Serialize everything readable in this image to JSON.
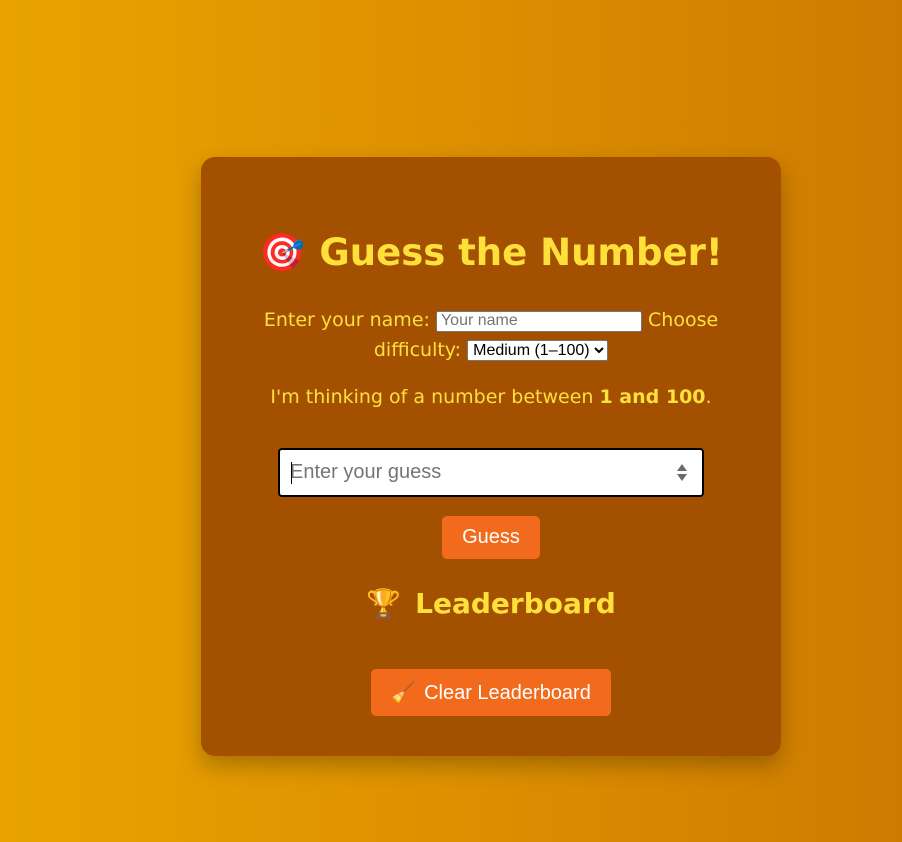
{
  "game": {
    "title_icon": "🎯",
    "title": "Guess the Number!",
    "name_label": "Enter your name:",
    "name_placeholder": "Your name",
    "name_value": "",
    "difficulty_label": "Choose difficulty:",
    "difficulty_selected": "Medium (1–100)",
    "hint_prefix": "I'm thinking of a number between ",
    "hint_range": "1 and 100",
    "hint_suffix": ".",
    "guess_placeholder": "Enter your guess",
    "guess_value": "",
    "guess_button": "Guess"
  },
  "leaderboard": {
    "icon": "🏆",
    "title": "Leaderboard",
    "clear_icon": "🧹",
    "clear_button": "Clear Leaderboard"
  },
  "colors": {
    "background_left": "#e9a300",
    "background_right": "#cd7b00",
    "card": "#a35000",
    "text": "#ffe03a",
    "button": "#f26a1b"
  }
}
